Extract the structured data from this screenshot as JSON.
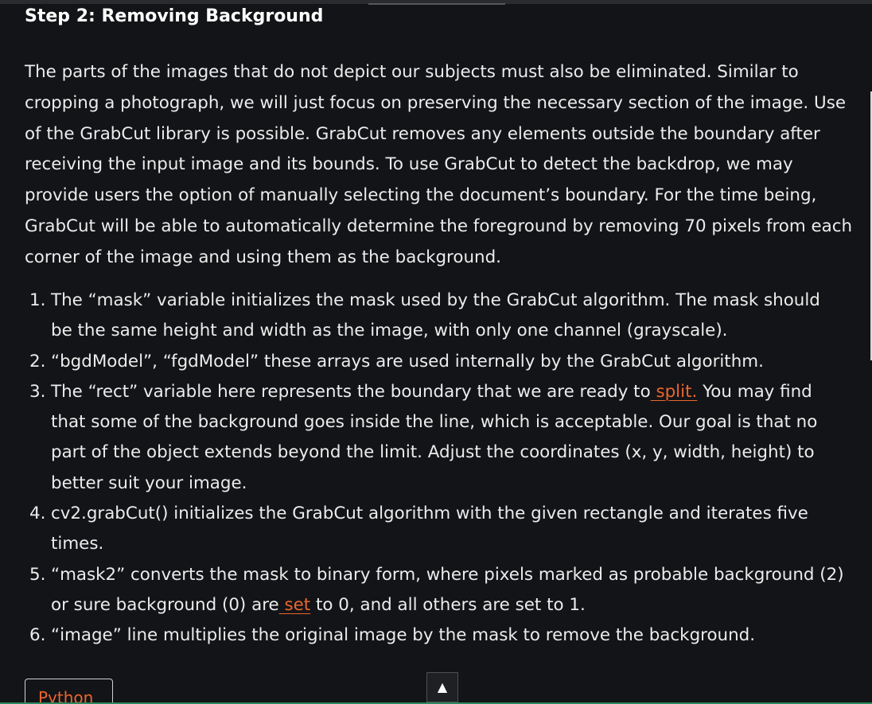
{
  "article": {
    "heading": "Step 2: Removing Background",
    "intro": "The parts of the images that do not depict our subjects must also be eliminated. Similar to cropping a photograph, we will just focus on preserving the necessary section of the image. Use of the GrabCut library is possible. GrabCut removes any elements outside the boundary after receiving the input image and its bounds. To use GrabCut to detect the backdrop, we may provide users the option of manually selecting the document’s boundary. For the time being, GrabCut will be able to automatically determine the foreground by removing 70 pixels from each corner of the image and using them as the background.",
    "steps": [
      {
        "num": "1.",
        "text": "The “mask” variable initializes the mask used by the GrabCut algorithm. The mask should be the same height and width as the image, with only one channel (grayscale)."
      },
      {
        "num": "2.",
        "text": "“bgdModel”, “fgdModel” these arrays are used internally by the GrabCut algorithm."
      },
      {
        "num": "3.",
        "before": "The “rect” variable here represents the boundary that we are ready to",
        "link": " split.",
        "after": " You may find that some of the background goes inside the line, which is acceptable. Our goal is that no part of the object extends beyond the limit. Adjust the coordinates (x, y, width, height) to better suit your image."
      },
      {
        "num": "4.",
        "text": "cv2.grabCut() initializes the GrabCut algorithm with the given rectangle and iterates five times."
      },
      {
        "num": "5.",
        "before": "“mask2” converts the mask to binary form, where pixels marked as probable background (2) or sure background (0) are",
        "link": " set",
        "after": " to 0, and all others are set to 1."
      },
      {
        "num": "6.",
        "text": "“image” line multiplies the original image by the mask to remove the background."
      }
    ]
  },
  "code_block": {
    "tab_label": "Python"
  },
  "scroll_top_button": {
    "icon": "▲",
    "icon_name": "arrow-up-icon"
  },
  "colors": {
    "background": "#131417",
    "text": "#ececec",
    "link": "#e9662f",
    "bottom_strip": "#2c8a5f"
  }
}
